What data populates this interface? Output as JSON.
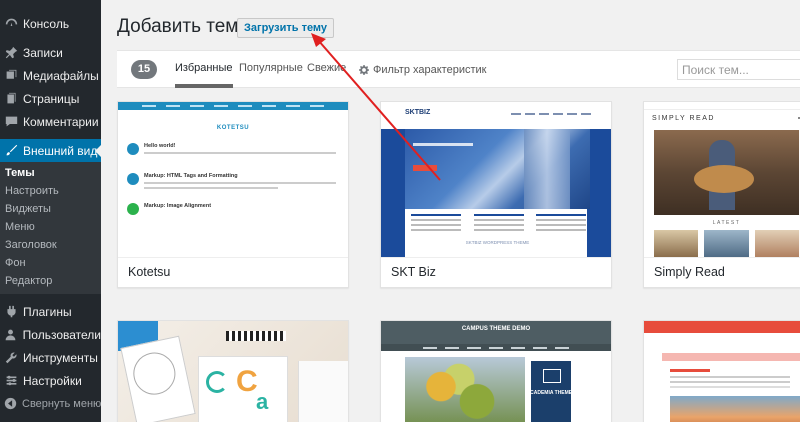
{
  "sidebar": {
    "items": [
      {
        "label": "Консоль",
        "icon": "dashboard-icon"
      },
      {
        "label": "Записи",
        "icon": "pin-icon"
      },
      {
        "label": "Медиафайлы",
        "icon": "media-icon"
      },
      {
        "label": "Страницы",
        "icon": "pages-icon"
      },
      {
        "label": "Комментарии",
        "icon": "comments-icon"
      },
      {
        "label": "Внешний вид",
        "icon": "appearance-brush-icon"
      },
      {
        "label": "Плагины",
        "icon": "plugins-icon"
      },
      {
        "label": "Пользователи",
        "icon": "users-icon"
      },
      {
        "label": "Инструменты",
        "icon": "tools-icon"
      },
      {
        "label": "Настройки",
        "icon": "settings-icon"
      }
    ],
    "submenu": [
      "Темы",
      "Настроить",
      "Виджеты",
      "Меню",
      "Заголовок",
      "Фон",
      "Редактор"
    ],
    "collapse_label": "Свернуть меню"
  },
  "header": {
    "title": "Добавить темы",
    "upload_label": "Загрузить тему"
  },
  "filter": {
    "count": "15",
    "tabs": [
      "Избранные",
      "Популярные",
      "Свежие"
    ],
    "feature_filter": "Фильтр характеристик",
    "search_placeholder": "Поиск тем..."
  },
  "themes": [
    {
      "name": "Kotetsu"
    },
    {
      "name": "SKT Biz"
    },
    {
      "name": "Simply Read"
    }
  ],
  "previews": {
    "kotetsu": {
      "site_title": "KOTETSU",
      "posts": [
        "Hello world!",
        "Markup: HTML Tags and Formatting",
        "Markup: Image Alignment"
      ]
    },
    "sktbiz": {
      "logo": "SKTBIZ",
      "footer": "SKTBIZ WORDPRESS THEME"
    },
    "simplyread": {
      "logo": "SIMPLY READ",
      "latest": "LATEST"
    },
    "row2_card1": {
      "logo2": "C",
      "logo3": "a"
    },
    "campus": {
      "title": "CAMPUS THEME DEMO",
      "badge": "ACADEMIA THEMES"
    }
  },
  "colors": {
    "sidebar_bg": "#23282d",
    "accent": "#0073aa",
    "annotation_arrow": "#e02020"
  }
}
